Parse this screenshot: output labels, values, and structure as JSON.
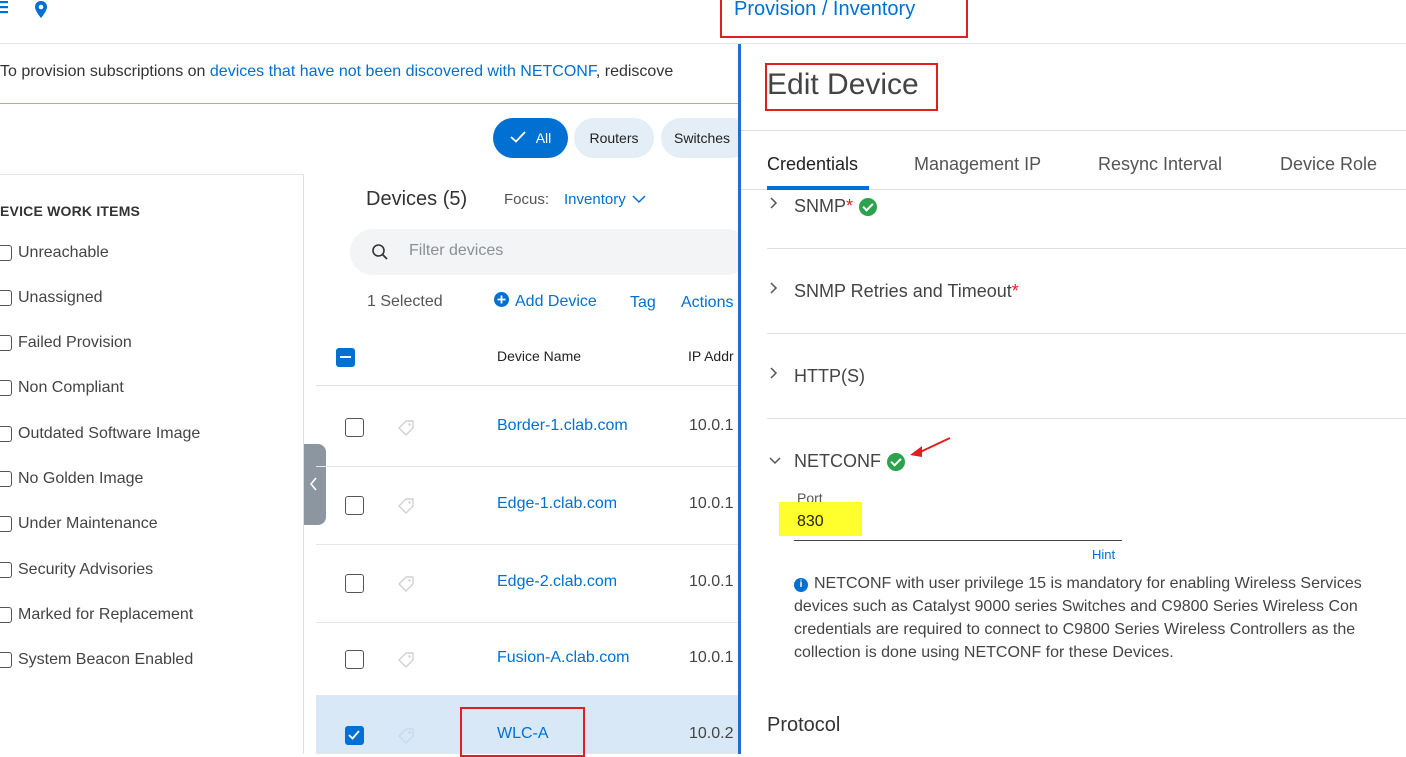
{
  "header": {
    "breadcrumb": "Provision  /  Inventory"
  },
  "banner": {
    "prefix": "To provision subscriptions on ",
    "link": "devices that have not been discovered with NETCONF",
    "suffix": ", rediscove"
  },
  "filters": [
    {
      "label": "All",
      "active": true
    },
    {
      "label": "Routers",
      "active": false
    },
    {
      "label": "Switches",
      "active": false
    }
  ],
  "sidebar": {
    "title": "EVICE WORK ITEMS",
    "items": [
      "Unreachable",
      "Unassigned",
      "Failed Provision",
      "Non Compliant",
      "Outdated Software Image",
      "No Golden Image",
      "Under Maintenance",
      "Security Advisories",
      "Marked for Replacement",
      "System Beacon Enabled"
    ]
  },
  "devices": {
    "title": "Devices (5)",
    "focus_label": "Focus:",
    "focus_value": "Inventory",
    "search_placeholder": "Filter devices",
    "selected": "1 Selected",
    "add_device": "Add Device",
    "tag": "Tag",
    "actions": "Actions",
    "columns": [
      "Device Name",
      "IP Addr"
    ],
    "rows": [
      {
        "name": "Border-1.clab.com",
        "ip": "10.0.1",
        "checked": false
      },
      {
        "name": "Edge-1.clab.com",
        "ip": "10.0.1",
        "checked": false
      },
      {
        "name": "Edge-2.clab.com",
        "ip": "10.0.1",
        "checked": false
      },
      {
        "name": "Fusion-A.clab.com",
        "ip": "10.0.1",
        "checked": false
      },
      {
        "name": "WLC-A",
        "ip": "10.0.2",
        "checked": true
      }
    ]
  },
  "drawer": {
    "title": "Edit Device",
    "tabs": [
      "Credentials",
      "Management IP",
      "Resync Interval",
      "Device Role"
    ],
    "sections": {
      "snmp": "SNMP",
      "snmp_retries": "SNMP Retries and Timeout",
      "https": "HTTP(S)",
      "netconf": "NETCONF"
    },
    "required_mark": "*",
    "port_label": "Port",
    "port_value": "830",
    "hint": "Hint",
    "info_lines": [
      "NETCONF with user privilege 15 is mandatory for enabling Wireless Services",
      "devices such as Catalyst 9000 series Switches and C9800 Series Wireless Con",
      "credentials are required to connect to C9800 Series Wireless Controllers as the",
      "collection is done using NETCONF for these Devices."
    ],
    "protocol": "Protocol"
  },
  "colors": {
    "accent": "#0070d2",
    "annotation_red": "#e02020",
    "highlight_yellow": "#ffff2e",
    "success_green": "#2ca24c"
  }
}
